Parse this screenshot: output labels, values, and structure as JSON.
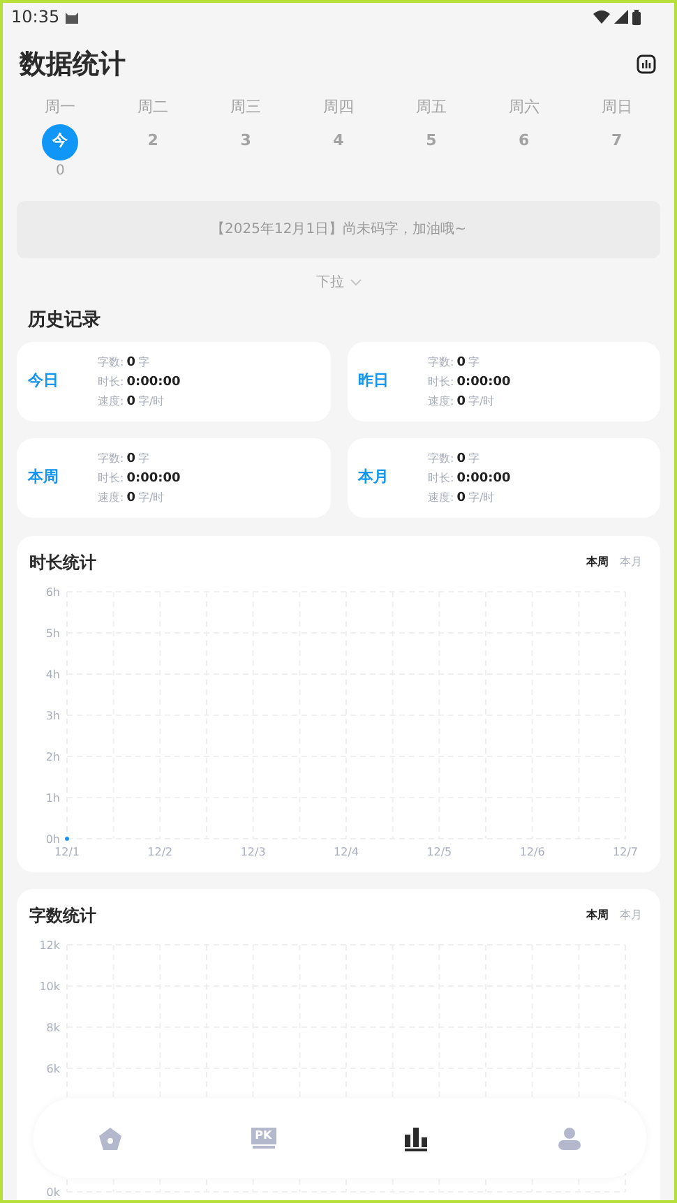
{
  "status_bar": {
    "time": "10:35"
  },
  "header": {
    "title": "数据统计"
  },
  "week": [
    {
      "weekday": "周一",
      "date": "今",
      "count": "0",
      "selected": true
    },
    {
      "weekday": "周二",
      "date": "2",
      "selected": false
    },
    {
      "weekday": "周三",
      "date": "3",
      "selected": false
    },
    {
      "weekday": "周四",
      "date": "4",
      "selected": false
    },
    {
      "weekday": "周五",
      "date": "5",
      "selected": false
    },
    {
      "weekday": "周六",
      "date": "6",
      "selected": false
    },
    {
      "weekday": "周日",
      "date": "7",
      "selected": false
    }
  ],
  "notice": "【2025年12月1日】尚未码字，加油哦~",
  "pull_down": "下拉",
  "history": {
    "title": "历史记录",
    "cards": [
      {
        "period": "今日",
        "rows": [
          {
            "label": "字数:",
            "value": "0",
            "unit": "字"
          },
          {
            "label": "时长:",
            "value": "0:00:00"
          },
          {
            "label": "速度:",
            "value": "0",
            "unit": "字/时"
          }
        ]
      },
      {
        "period": "昨日",
        "rows": [
          {
            "label": "字数:",
            "value": "0",
            "unit": "字"
          },
          {
            "label": "时长:",
            "value": "0:00:00"
          },
          {
            "label": "速度:",
            "value": "0",
            "unit": "字/时"
          }
        ]
      },
      {
        "period": "本周",
        "rows": [
          {
            "label": "字数:",
            "value": "0",
            "unit": "字"
          },
          {
            "label": "时长:",
            "value": "0:00:00"
          },
          {
            "label": "速度:",
            "value": "0",
            "unit": "字/时"
          }
        ]
      },
      {
        "period": "本月",
        "rows": [
          {
            "label": "字数:",
            "value": "0",
            "unit": "字"
          },
          {
            "label": "时长:",
            "value": "0:00:00"
          },
          {
            "label": "速度:",
            "value": "0",
            "unit": "字/时"
          }
        ]
      }
    ]
  },
  "charts": [
    {
      "title": "时长统计",
      "tabs": [
        {
          "label": "本周",
          "selected": true
        },
        {
          "label": "本月",
          "selected": false
        }
      ],
      "chart_data": {
        "type": "line",
        "categories": [
          "12/1",
          "12/2",
          "12/3",
          "12/4",
          "12/5",
          "12/6",
          "12/7"
        ],
        "grid": true,
        "series": [
          {
            "color": "#2196f3",
            "marker": true,
            "values": [
              0,
              null,
              null,
              null,
              null,
              null,
              null
            ]
          }
        ],
        "ylim": [
          0,
          6
        ],
        "yticks": [
          {
            "value": 0,
            "label": "0h"
          },
          {
            "value": 1,
            "label": "1h"
          },
          {
            "value": 2,
            "label": "2h"
          },
          {
            "value": 3,
            "label": "3h"
          },
          {
            "value": 4,
            "label": "4h"
          },
          {
            "value": 5,
            "label": "5h"
          },
          {
            "value": 6,
            "label": "6h"
          }
        ]
      }
    },
    {
      "title": "字数统计",
      "tabs": [
        {
          "label": "本周",
          "selected": true
        },
        {
          "label": "本月",
          "selected": false
        }
      ],
      "chart_data": {
        "type": "line",
        "grid": true,
        "categories": [
          null,
          null,
          null,
          null,
          null,
          null,
          null
        ],
        "ylim": [
          0,
          12
        ],
        "yticks": [
          {
            "value": 0,
            "label": "0k"
          },
          {
            "value": 6,
            "label": "6k"
          },
          {
            "value": 8,
            "label": "8k"
          },
          {
            "value": 10,
            "label": "10k"
          },
          {
            "value": 12,
            "label": "12k"
          }
        ]
      }
    }
  ],
  "nav": [
    {
      "kind": "home",
      "selected": false
    },
    {
      "kind": "pk",
      "text": "PK",
      "selected": false
    },
    {
      "kind": "stats",
      "selected": true
    },
    {
      "kind": "profile",
      "selected": false
    }
  ]
}
